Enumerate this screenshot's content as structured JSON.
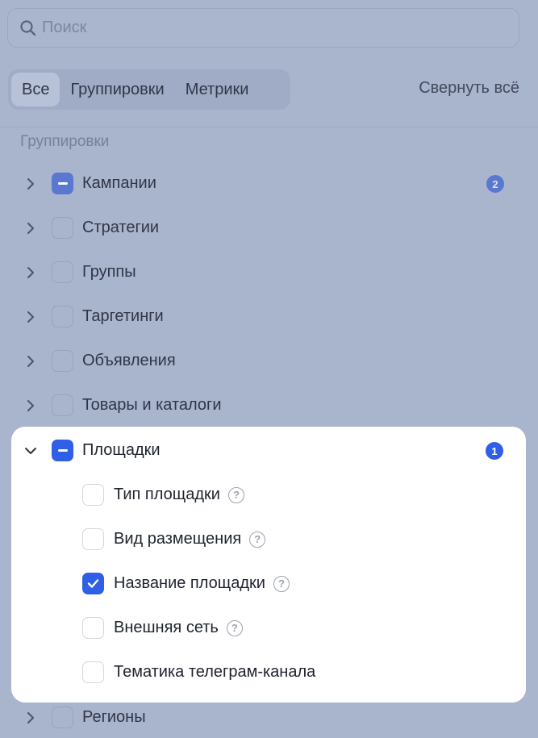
{
  "search": {
    "placeholder": "Поиск"
  },
  "tabs": [
    {
      "label": "Все",
      "active": true
    },
    {
      "label": "Группировки",
      "active": false
    },
    {
      "label": "Метрики",
      "active": false
    }
  ],
  "collapse_all_label": "Свернуть всё",
  "section_title": "Группировки",
  "groups": [
    {
      "label": "Кампании",
      "state": "mixed",
      "badge": "2"
    },
    {
      "label": "Стратегии",
      "state": "unchecked"
    },
    {
      "label": "Группы",
      "state": "unchecked"
    },
    {
      "label": "Таргетинги",
      "state": "unchecked"
    },
    {
      "label": "Объявления",
      "state": "unchecked"
    },
    {
      "label": "Товары и каталоги",
      "state": "unchecked"
    }
  ],
  "expanded": {
    "label": "Площадки",
    "state": "mixed",
    "badge": "1",
    "children": [
      {
        "label": "Тип площадки",
        "checked": false,
        "help": true
      },
      {
        "label": "Вид размещения",
        "checked": false,
        "help": true
      },
      {
        "label": "Название площадки",
        "checked": true,
        "help": true
      },
      {
        "label": "Внешняя сеть",
        "checked": false,
        "help": true
      },
      {
        "label": "Тематика телеграм-канала",
        "checked": false,
        "help": false
      }
    ]
  },
  "after_groups": [
    {
      "label": "Регионы",
      "state": "unchecked"
    }
  ],
  "help_glyph": "?",
  "colors": {
    "accent": "#2f5fe7",
    "overlay": "#a9b4cd",
    "panel": "#ffffff"
  }
}
